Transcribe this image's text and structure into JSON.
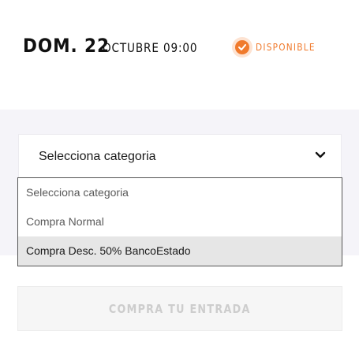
{
  "event": {
    "day": "DOM. 22",
    "date_rest": "OCTUBRE 09:00",
    "status_label": "DISPONIBLE",
    "status_icon": "check-circle-icon",
    "accent_color": "#f07a2c"
  },
  "category_select": {
    "selected": "Selecciona categoria",
    "icon": "chevron-down-icon",
    "options": [
      "Selecciona categoria",
      "Compra Normal",
      "Compra Desc. 50% BancoEstado"
    ],
    "highlighted_option": "Compra Desc. 50% BancoEstado"
  },
  "buy_button": {
    "label": "COMPRA TU ENTRADA",
    "state": "disabled"
  }
}
